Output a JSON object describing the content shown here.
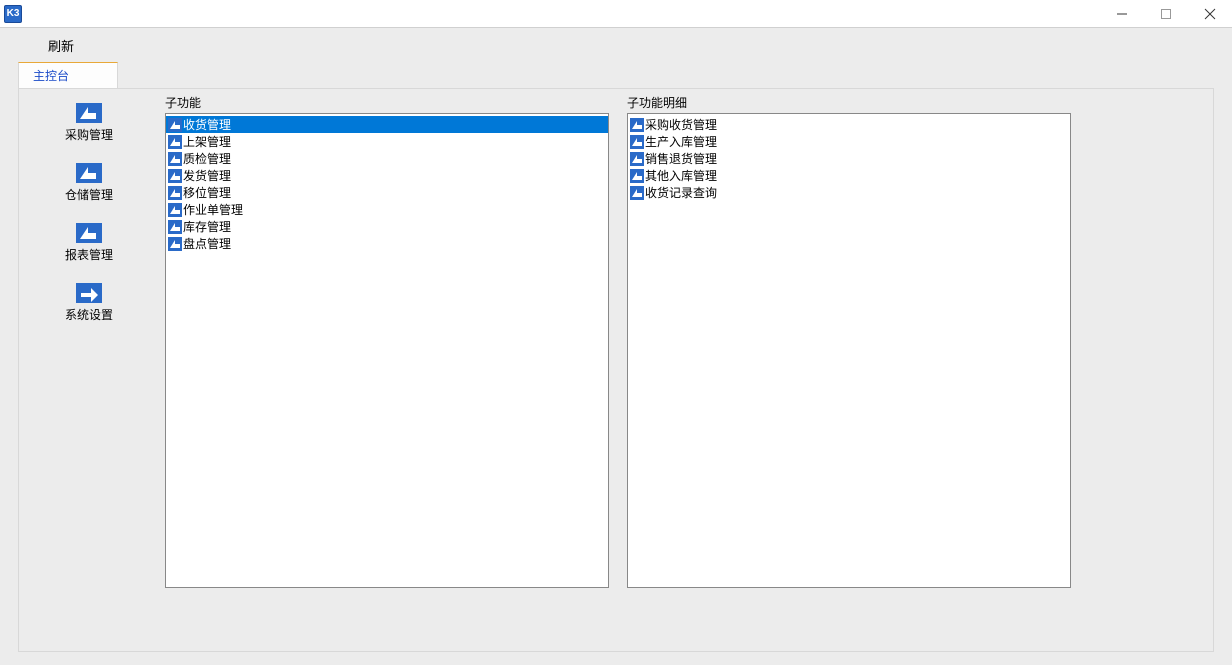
{
  "app_icon_text": "K3",
  "toolbar": {
    "refresh": "刷新"
  },
  "tab": {
    "active": "主控台"
  },
  "sidebar": {
    "items": [
      {
        "label": "采购管理"
      },
      {
        "label": "仓储管理"
      },
      {
        "label": "报表管理"
      },
      {
        "label": "系统设置"
      }
    ]
  },
  "sub_function": {
    "title": "子功能",
    "items": [
      {
        "label": "收货管理",
        "selected": true
      },
      {
        "label": "上架管理"
      },
      {
        "label": "质检管理"
      },
      {
        "label": "发货管理"
      },
      {
        "label": "移位管理"
      },
      {
        "label": "作业单管理"
      },
      {
        "label": "库存管理"
      },
      {
        "label": "盘点管理"
      }
    ]
  },
  "sub_function_detail": {
    "title": "子功能明细",
    "items": [
      {
        "label": "采购收货管理"
      },
      {
        "label": "生产入库管理"
      },
      {
        "label": "销售退货管理"
      },
      {
        "label": "其他入库管理"
      },
      {
        "label": "收货记录查询"
      }
    ]
  }
}
